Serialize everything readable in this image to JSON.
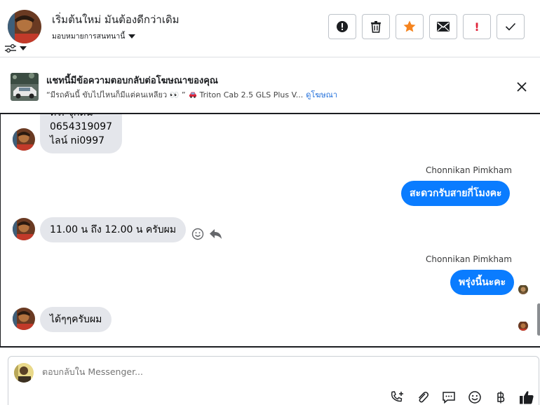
{
  "header": {
    "title": "เริ่มต้นใหม่ มันต้องดีกว่าเดิม",
    "assign_label": "มอบหมายการสนทนานี้",
    "actions": [
      "alert-icon",
      "trash-icon",
      "star-icon",
      "mail-icon",
      "important-icon",
      "check-icon"
    ],
    "important_glyph": "!"
  },
  "ad_banner": {
    "title": "แชทนี้มีข้อความตอบกลับต่อโฆษณาของคุณ",
    "quote": "“มีรถคันนี้ ขับไปไหนก็มีแต่คนเหลียว 👀 ”",
    "vehicle": "Triton Cab 2.5 GLS Plus V...",
    "link": "ดูโฆษณา"
  },
  "messages": {
    "m1_partial": "ทร. จุกดน",
    "m1_line1": "0654319097",
    "m1_line2": "ไลน์ ni0997",
    "sender1": "Chonnikan Pimkham",
    "m2": "สะดวกรับสายกี่โมงคะ",
    "m3": "11.00 น ถึง 12.00 น ครับผม",
    "sender2": "Chonnikan Pimkham",
    "m4": "พรุ่งนี้นะคะ",
    "m5": "ได้ๆๆครับผม"
  },
  "composer": {
    "placeholder": "ตอบกลับใน Messenger...",
    "tools": [
      "call-icon",
      "attach-icon",
      "saved-reply-icon",
      "emoji-icon",
      "baht-icon",
      "like-icon"
    ]
  },
  "colors": {
    "accent": "#0a7cff",
    "incoming": "#e4e6eb",
    "star": "#f5841f",
    "important": "#e0243a",
    "link": "#216fdb"
  }
}
